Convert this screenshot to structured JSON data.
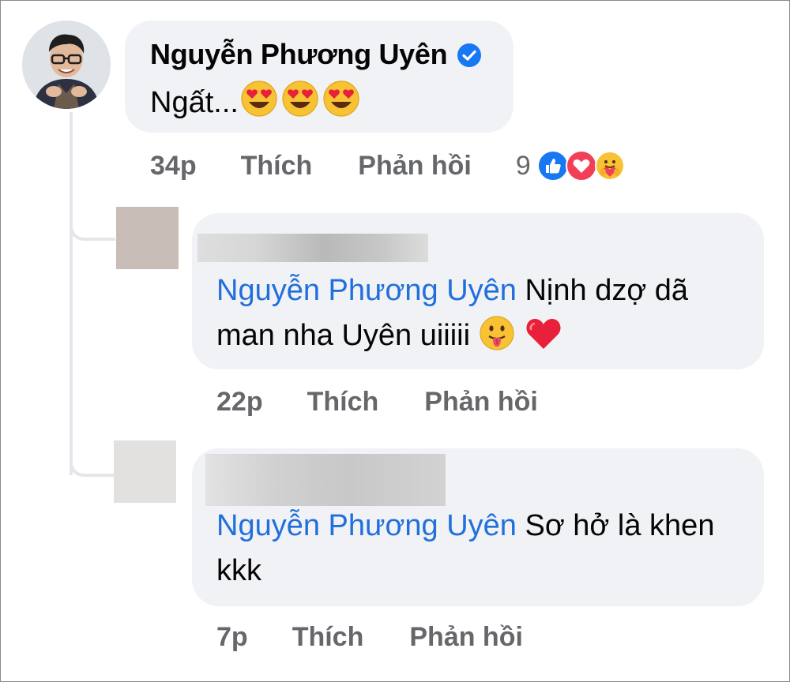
{
  "main_comment": {
    "author": "Nguyễn Phương Uyên",
    "text": "Ngất...",
    "emojis": [
      "heart-eyes-emoji",
      "heart-eyes-emoji",
      "heart-eyes-emoji"
    ],
    "time": "34p",
    "like_label": "Thích",
    "reply_label": "Phản hồi",
    "reaction_count": "9",
    "reaction_icons": [
      "like-reaction-icon",
      "love-reaction-icon",
      "care-reaction-icon"
    ]
  },
  "replies": [
    {
      "mention": "Nguyễn Phương Uyên",
      "text": " Nịnh dzợ dã man nha Uyên uiiiii ",
      "emojis": [
        "tongue-emoji",
        "red-heart-emoji"
      ],
      "time": "22p",
      "like_label": "Thích",
      "reply_label": "Phản hồi"
    },
    {
      "mention": "Nguyễn Phương Uyên",
      "text": " Sơ hở là khen kkk",
      "time": "7p",
      "like_label": "Thích",
      "reply_label": "Phản hồi"
    }
  ],
  "colors": {
    "bubble": "#f0f2f5",
    "mention": "#216fdb",
    "meta_text": "#65676b",
    "verified": "#1877f2"
  }
}
